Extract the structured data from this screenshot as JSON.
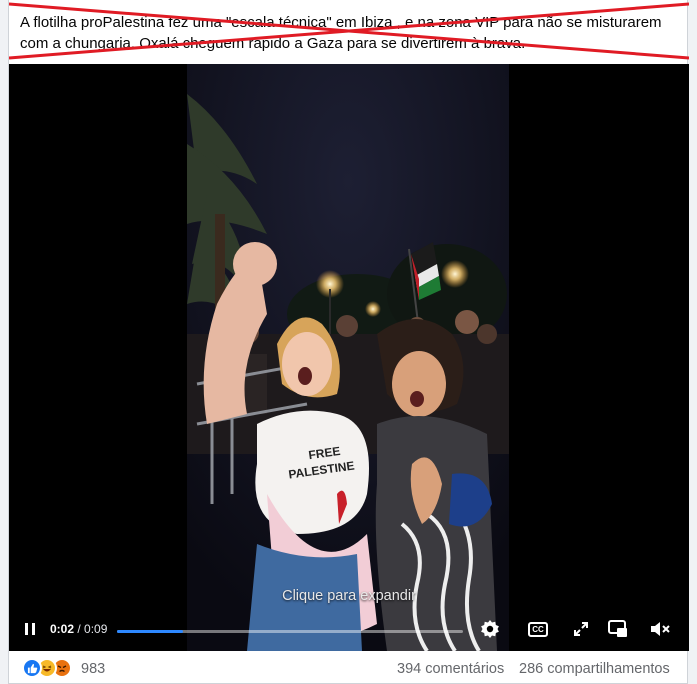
{
  "post": {
    "caption": "A flotilha proPalestina fez uma \"escala técnica\" em Ibiza , e na zona VIP para não se misturarem com a chungaria. Oxalá cheguem rápido a Gaza para se divertirem à brava."
  },
  "video": {
    "expand_hint": "Clique para expandir",
    "shirt_text": [
      "FREE",
      "PALESTINE"
    ],
    "current_time": "0:02",
    "separator": " / ",
    "duration": "0:09",
    "progress_fraction": 0.19,
    "controls": {
      "play_pause_icon": "pause-icon",
      "settings_icon": "gear-icon",
      "captions_label": "CC",
      "expand_icon": "expand-icon",
      "pip_icon": "picture-in-picture-icon",
      "volume_icon": "volume-muted-icon"
    }
  },
  "footer": {
    "reaction_count": "983",
    "reactions": [
      "like",
      "haha",
      "angry"
    ],
    "comments": "394 comentários",
    "shares": "286 compartilhamentos"
  },
  "colors": {
    "cross_red": "#e01b24",
    "progress_blue": "#2d88ff",
    "like_blue": "#1877f2",
    "haha_yellow": "#f7b928",
    "angry_orange": "#e9710f"
  }
}
